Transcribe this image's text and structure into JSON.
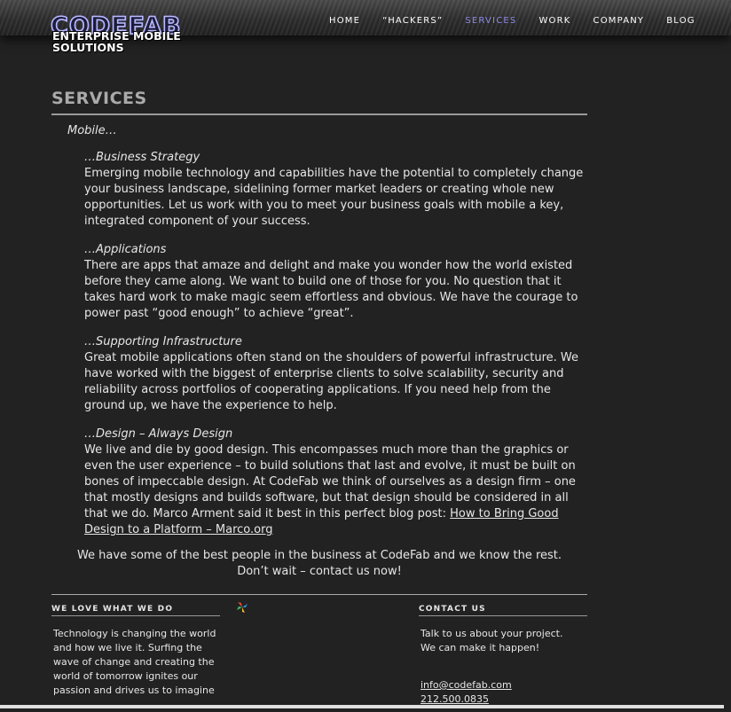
{
  "logo": {
    "main": "CODEFAB",
    "sub": "ENTERPRISE MOBILE SOLUTIONS"
  },
  "nav": [
    "HOME",
    "“HACKERS”",
    "SERVICES",
    "WORK",
    "COMPANY",
    "BLOG"
  ],
  "active_nav": "SERVICES",
  "colors": {
    "background": "#222222",
    "accent": "#8a8ae6",
    "text": "#e6e6e6"
  },
  "page": {
    "title": "SERVICES",
    "intro": "Mobile…",
    "sections": [
      {
        "heading": "…Business Strategy",
        "text": "Emerging mobile technology and capabilities have the potential to completely change your business landscape, sidelining former market leaders or creating whole new opportunities. Let us work with you to meet your business goals with mobile a key, integrated component of your success."
      },
      {
        "heading": "…Applications",
        "text": "There are apps that amaze and delight and make you wonder how the world existed before they came along. We want to build one of those for you. No question that it takes hard work to make magic seem effortless and obvious. We have the courage to power past “good enough” to achieve “great”."
      },
      {
        "heading": "…Supporting Infrastructure",
        "text": "Great mobile applications often stand on the shoulders of powerful infrastructure. We have worked with the biggest of enterprise clients to solve scalability, security and reliability across portfolios of cooperating applications. If you need help from the ground up, we have the experience to help."
      },
      {
        "heading": "…Design – Always Design",
        "text": "We live and die by good design. This encompasses much more than the graphics or even the user experience – to build solutions that last and evolve, it must be built on bones of impeccable design. At CodeFab we think of ourselves as a design firm – one that mostly designs and builds software, but that design should be considered in all that we do. Marco Arment said it best in this perfect blog post: ",
        "link": "How to Bring Good Design to a Platform – Marco.org"
      }
    ],
    "closing_line1": "We have some of the best people in the business at CodeFab and we know the rest.",
    "closing_line2": "Don’t wait – contact us now!"
  },
  "footer": {
    "left_heading": "WE LOVE WHAT WE DO",
    "left_text": "Technology is changing the world and how we live it. Surfing the wave of change and creating the world of tomorrow ignites our passion and drives us to imagine ...",
    "right_heading": "CONTACT US",
    "right_line1": "Talk to us about your project.",
    "right_line2": "We can make it happen!",
    "email": "info@codefab.com",
    "phone": "212.500.0835"
  }
}
